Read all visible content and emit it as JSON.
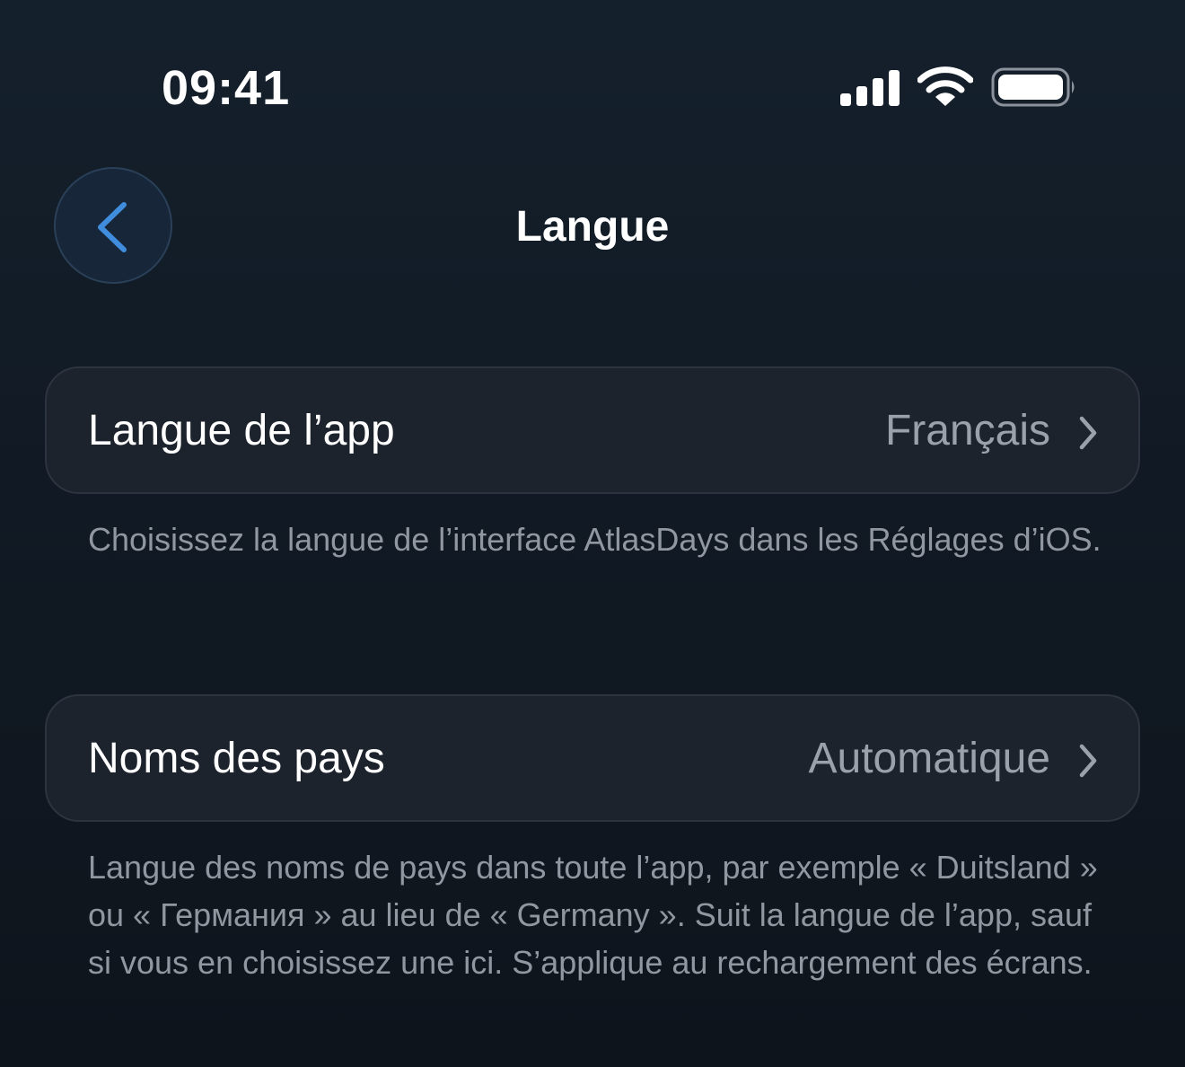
{
  "status_bar": {
    "time": "09:41",
    "icons": [
      "signal-icon",
      "wifi-icon",
      "battery-icon"
    ]
  },
  "nav": {
    "back_icon": "chevron-left-icon",
    "title": "Langue"
  },
  "rows": [
    {
      "label": "Langue de l’app",
      "value": "Français",
      "footnote": "Choisissez la langue de l’interface AtlasDays dans les Réglages d’iOS."
    },
    {
      "label": "Noms des pays",
      "value": "Automatique",
      "footnote": "Langue des noms de pays dans toute l’app, par exemple « Duitsland » ou « Германия » au lieu de « Germany ». Suit la langue de l’app, sauf si vous en choisissez une ici. S’applique au rechargement des écrans."
    }
  ],
  "colors": {
    "accent": "#3f8ddc",
    "card_background": "#1d232d",
    "secondary_text": "#9ba1ab"
  }
}
